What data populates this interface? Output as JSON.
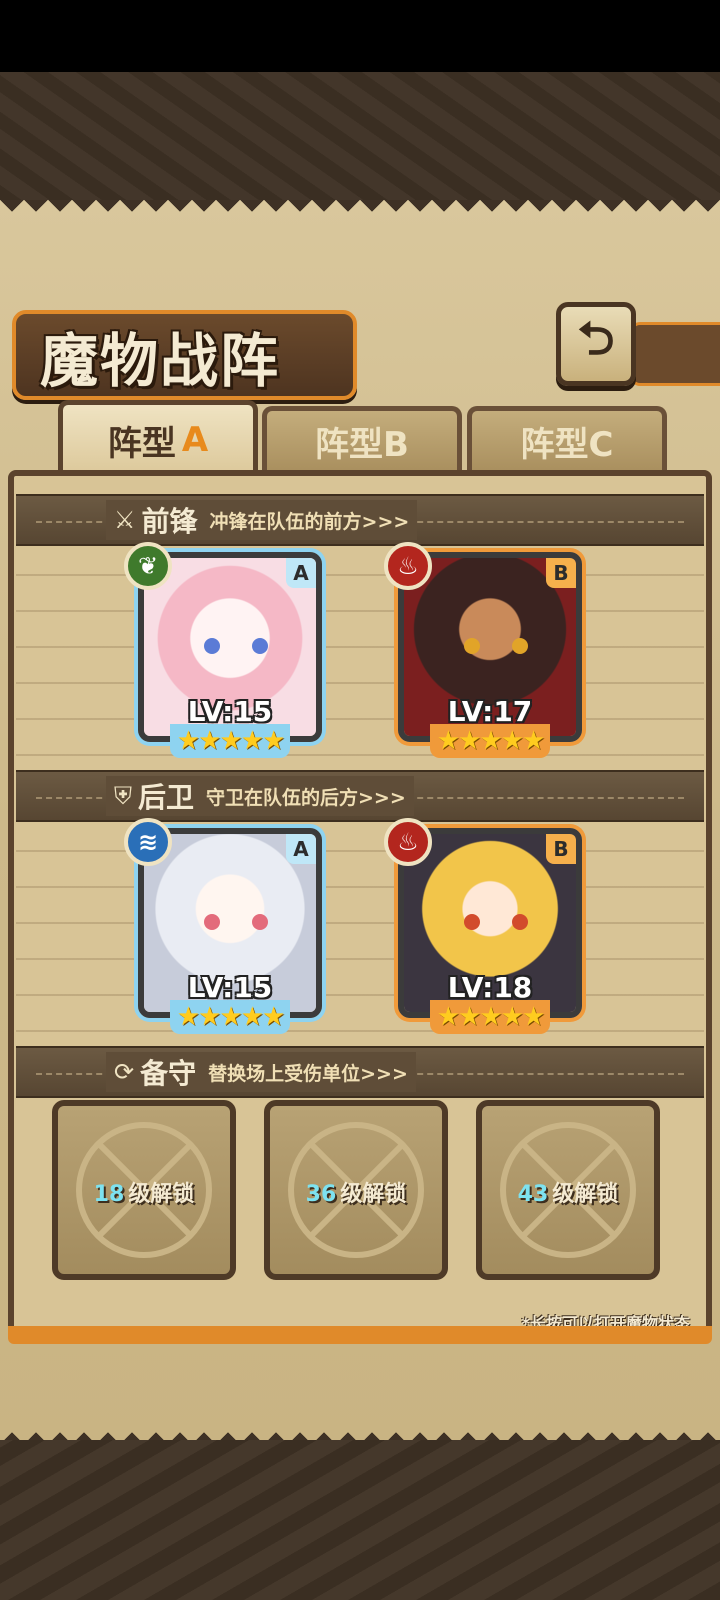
{
  "title": "魔物战阵",
  "back_button": {
    "icon": "back-arrow-icon"
  },
  "tabs": [
    {
      "prefix": "阵型",
      "letter": "A",
      "active": true
    },
    {
      "label": "阵型B",
      "active": false
    },
    {
      "label": "阵型C",
      "active": false
    }
  ],
  "sections": {
    "front": {
      "icon": "sword-icon",
      "name": "前锋",
      "desc": "冲锋在队伍的前方>>>"
    },
    "rear": {
      "icon": "shield-icon",
      "name": "后卫",
      "desc": "守卫在队伍的后方>>>"
    },
    "reserve": {
      "icon": "refresh-icon",
      "name": "备守",
      "desc": "替换场上受伤单位>>>"
    }
  },
  "front_units": [
    {
      "level": "LV:15",
      "grade": "A",
      "element": "nature",
      "stars": "★★★★★"
    },
    {
      "level": "LV:17",
      "grade": "B",
      "element": "fire",
      "stars": "★★★★★"
    }
  ],
  "rear_units": [
    {
      "level": "LV:15",
      "grade": "A",
      "element": "water",
      "stars": "★★★★★"
    },
    {
      "level": "LV:18",
      "grade": "B",
      "element": "fire",
      "stars": "★★★★★"
    }
  ],
  "reserve_slots": [
    {
      "num": "18",
      "text": "级解锁"
    },
    {
      "num": "36",
      "text": "级解锁"
    },
    {
      "num": "43",
      "text": "级解锁"
    }
  ],
  "hint": "*长按可以打开魔物状态",
  "colors": {
    "accent": "#e08a2a",
    "grade_a": "#8ed3f0",
    "grade_b": "#f09a3a",
    "unlock_num": "#7de2f0"
  }
}
